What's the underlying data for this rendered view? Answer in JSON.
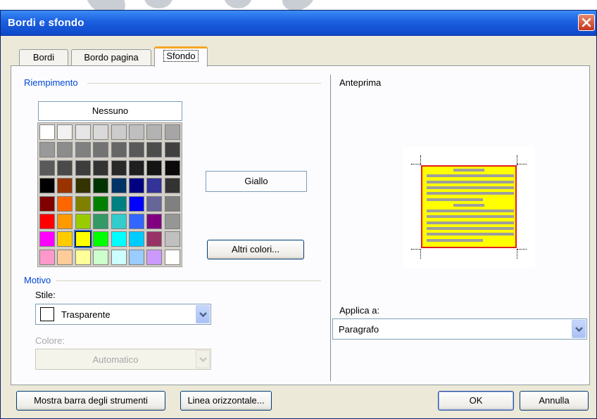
{
  "window": {
    "title": "Bordi e sfondo"
  },
  "tabs": [
    {
      "label": "Bordi",
      "active": false
    },
    {
      "label": "Bordo pagina",
      "active": false
    },
    {
      "label": "Sfondo",
      "active": true
    }
  ],
  "fill": {
    "group_label": "Riempimento",
    "none_button": "Nessuno",
    "selected_color_name": "Giallo",
    "more_colors_button": "Altri colori...",
    "palette": [
      [
        "#ffffff",
        "#f2f2f2",
        "#e6e6e6",
        "#d9d9d9",
        "#cccccc",
        "#bfbfbf",
        "#b3b3b3",
        "#a6a6a6"
      ],
      [
        "#999999",
        "#8c8c8c",
        "#808080",
        "#737373",
        "#666666",
        "#595959",
        "#4d4d4d",
        "#404040"
      ],
      [
        "#5a5a5a",
        "#4a4a4a",
        "#3d3d3d",
        "#333333",
        "#292929",
        "#1f1f1f",
        "#141414",
        "#0a0a0a"
      ],
      [
        "#000000",
        "#993300",
        "#333300",
        "#003300",
        "#003366",
        "#000080",
        "#333399",
        "#333333"
      ],
      [
        "#800000",
        "#ff6600",
        "#808000",
        "#008000",
        "#008080",
        "#0000ff",
        "#666699",
        "#808080"
      ],
      [
        "#ff0000",
        "#ff9900",
        "#99cc00",
        "#339966",
        "#33cccc",
        "#3366ff",
        "#800080",
        "#969696"
      ],
      [
        "#ff00ff",
        "#ffcc00",
        "#ffff00",
        "#00ff00",
        "#00ffff",
        "#00ccff",
        "#993366",
        "#c0c0c0"
      ],
      [
        "#ff99cc",
        "#ffcc99",
        "#ffff99",
        "#ccffcc",
        "#ccffff",
        "#99ccff",
        "#cc99ff",
        "#ffffff"
      ]
    ],
    "selected_color": "#ffff00"
  },
  "pattern": {
    "group_label": "Motivo",
    "style_label": "Stile:",
    "style_value": "Trasparente",
    "color_label": "Colore:",
    "color_value": "Automatico"
  },
  "preview": {
    "label": "Anteprima",
    "fill_color": "#ffff00",
    "border_color": "#e02020"
  },
  "apply": {
    "label": "Applica a:",
    "value": "Paragrafo"
  },
  "footer": {
    "toolbar_button": "Mostra barra degli strumenti",
    "hline_button": "Linea orizzontale...",
    "ok_button": "OK",
    "cancel_button": "Annulla"
  }
}
